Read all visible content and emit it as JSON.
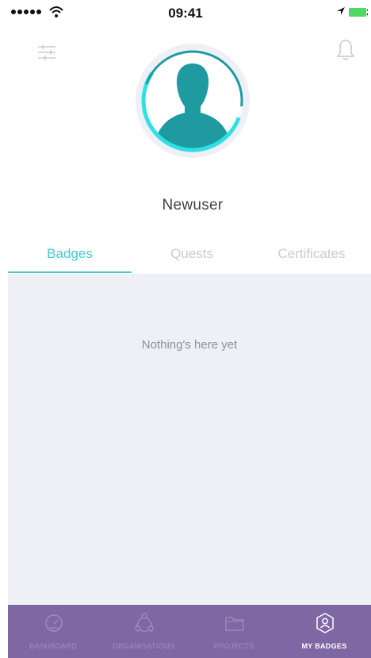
{
  "status_bar": {
    "time": "09:41"
  },
  "profile": {
    "username": "Newuser"
  },
  "tabs": [
    {
      "label": "Badges",
      "active": true
    },
    {
      "label": "Quests",
      "active": false
    },
    {
      "label": "Certificates",
      "active": false
    }
  ],
  "content": {
    "empty_message": "Nothing's here yet"
  },
  "bottom_nav": [
    {
      "label": "DASHBOARD",
      "icon": "dashboard-gauge-icon",
      "active": false
    },
    {
      "label": "ORGANISATIONS",
      "icon": "network-icon",
      "active": false
    },
    {
      "label": "PROJECTS",
      "icon": "folder-icon",
      "active": false
    },
    {
      "label": "MY BADGES",
      "icon": "badge-user-icon",
      "active": true
    }
  ],
  "colors": {
    "accent": "#46c8cf",
    "nav_background": "#7f67a3",
    "content_background": "#eef0f5",
    "avatar_teal": "#1e9aa0"
  }
}
